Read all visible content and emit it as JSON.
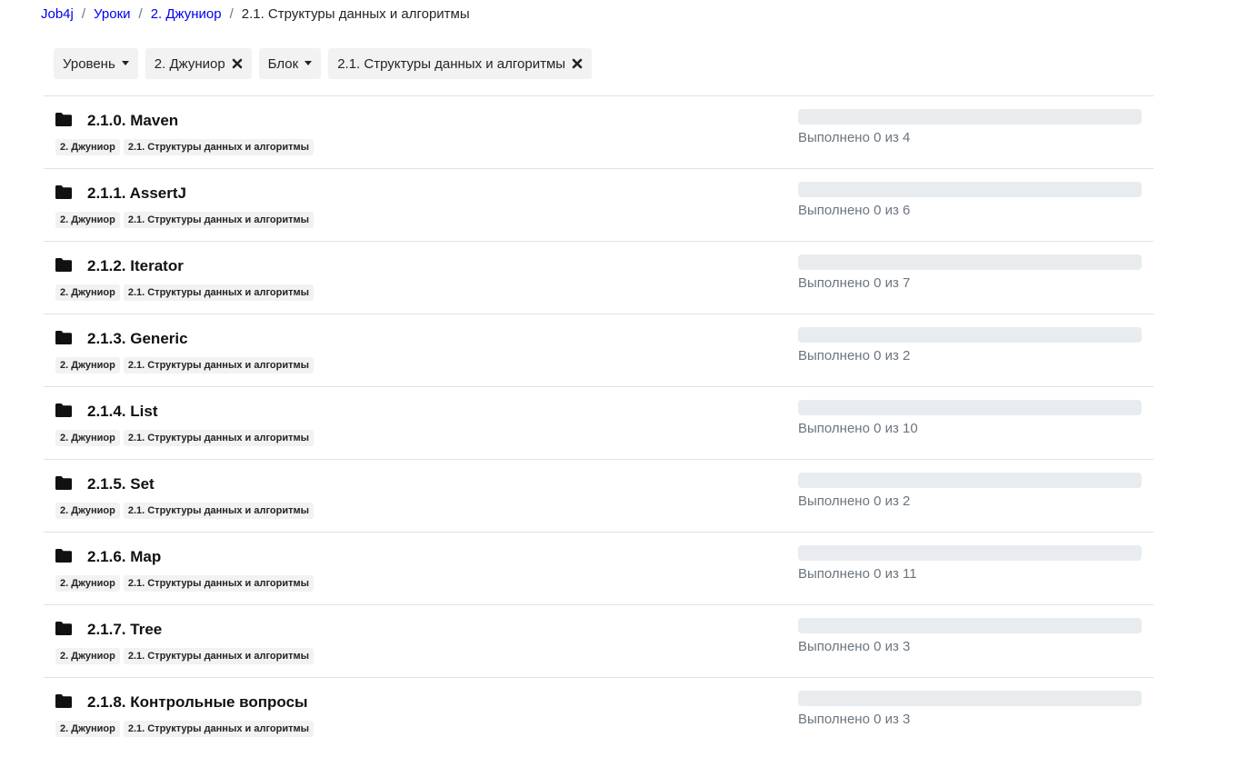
{
  "breadcrumb": [
    {
      "label": "Job4j",
      "link": true
    },
    {
      "label": "Уроки",
      "link": true
    },
    {
      "label": "2. Джуниор",
      "link": true
    },
    {
      "label": "2.1. Структуры данных и алгоритмы",
      "link": false
    }
  ],
  "filters": {
    "level_label": "Уровень",
    "level_value": "2. Джуниор",
    "block_label": "Блок",
    "block_value": "2.1. Структуры данных и алгоритмы"
  },
  "topics": [
    {
      "title": "2.1.0. Maven",
      "badges": [
        "2. Джуниор",
        "2.1. Структуры данных и алгоритмы"
      ],
      "status": "Выполнено 0 из 4",
      "progress": 0
    },
    {
      "title": "2.1.1. AssertJ",
      "badges": [
        "2. Джуниор",
        "2.1. Структуры данных и алгоритмы"
      ],
      "status": "Выполнено 0 из 6",
      "progress": 0
    },
    {
      "title": "2.1.2. Iterator",
      "badges": [
        "2. Джуниор",
        "2.1. Структуры данных и алгоритмы"
      ],
      "status": "Выполнено 0 из 7",
      "progress": 0
    },
    {
      "title": "2.1.3. Generic",
      "badges": [
        "2. Джуниор",
        "2.1. Структуры данных и алгоритмы"
      ],
      "status": "Выполнено 0 из 2",
      "progress": 0
    },
    {
      "title": "2.1.4. List",
      "badges": [
        "2. Джуниор",
        "2.1. Структуры данных и алгоритмы"
      ],
      "status": "Выполнено 0 из 10",
      "progress": 0
    },
    {
      "title": "2.1.5. Set",
      "badges": [
        "2. Джуниор",
        "2.1. Структуры данных и алгоритмы"
      ],
      "status": "Выполнено 0 из 2",
      "progress": 0
    },
    {
      "title": "2.1.6. Map",
      "badges": [
        "2. Джуниор",
        "2.1. Структуры данных и алгоритмы"
      ],
      "status": "Выполнено 0 из 11",
      "progress": 0
    },
    {
      "title": "2.1.7. Tree",
      "badges": [
        "2. Джуниор",
        "2.1. Структуры данных и алгоритмы"
      ],
      "status": "Выполнено 0 из 3",
      "progress": 0
    },
    {
      "title": "2.1.8. Контрольные вопросы",
      "badges": [
        "2. Джуниор",
        "2.1. Структуры данных и алгоритмы"
      ],
      "status": "Выполнено 0 из 3",
      "progress": 0
    }
  ],
  "icons": {
    "row_icon": "folder-icon",
    "remove_icon": "close-icon",
    "dropdown_icon": "caret-down-icon"
  },
  "colors": {
    "link": "#0000ee",
    "chip_bg": "#f2f2f2",
    "progress_track": "#e9ecef",
    "muted_text": "#6c757d"
  }
}
